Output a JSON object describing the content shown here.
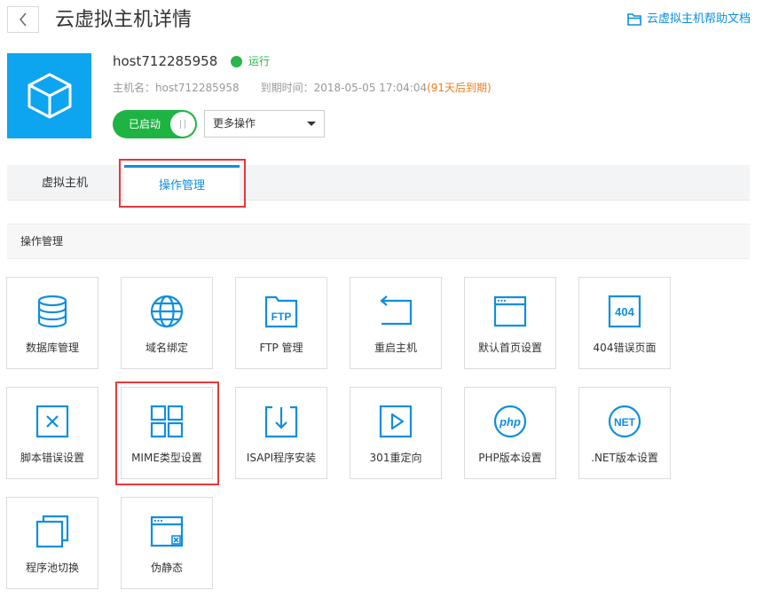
{
  "header": {
    "title": "云虚拟主机详情",
    "help_link": "云虚拟主机帮助文档"
  },
  "host": {
    "name": "host712285958",
    "status": "运行",
    "hostname_label": "主机名：",
    "hostname": "host712285958",
    "expire_label": "到期时间：",
    "expire_time": "2018-05-05 17:04:04",
    "expire_note": "(91天后到期)",
    "toggle_label": "已启动",
    "more_actions": "更多操作"
  },
  "tabs": [
    {
      "label": "虚拟主机",
      "active": false
    },
    {
      "label": "操作管理",
      "active": true
    }
  ],
  "section_title": "操作管理",
  "cards": [
    {
      "label": "数据库管理",
      "icon": "database-icon"
    },
    {
      "label": "域名绑定",
      "icon": "globe-icon"
    },
    {
      "label": "FTP 管理",
      "icon": "ftp-folder-icon",
      "icon_text": "FTP"
    },
    {
      "label": "重启主机",
      "icon": "restart-icon"
    },
    {
      "label": "默认首页设置",
      "icon": "browser-window-icon"
    },
    {
      "label": "404错误页面",
      "icon": "404-icon",
      "icon_text": "404"
    },
    {
      "label": "脚本错误设置",
      "icon": "error-x-icon"
    },
    {
      "label": "MIME类型设置",
      "icon": "grid-icon"
    },
    {
      "label": "ISAPI程序安装",
      "icon": "install-box-icon"
    },
    {
      "label": "301重定向",
      "icon": "redirect-play-icon"
    },
    {
      "label": "PHP版本设置",
      "icon": "php-icon",
      "icon_text": "php"
    },
    {
      "label": ".NET版本设置",
      "icon": "net-icon",
      "icon_text": "NET"
    },
    {
      "label": "程序池切换",
      "icon": "app-pool-icon"
    },
    {
      "label": "伪静态",
      "icon": "rewrite-window-icon"
    }
  ],
  "colors": {
    "accent": "#0e8ee0",
    "logo_bg": "#0da4f0",
    "running": "#2cb549",
    "warning": "#f07c18",
    "highlight": "#e8383d"
  }
}
